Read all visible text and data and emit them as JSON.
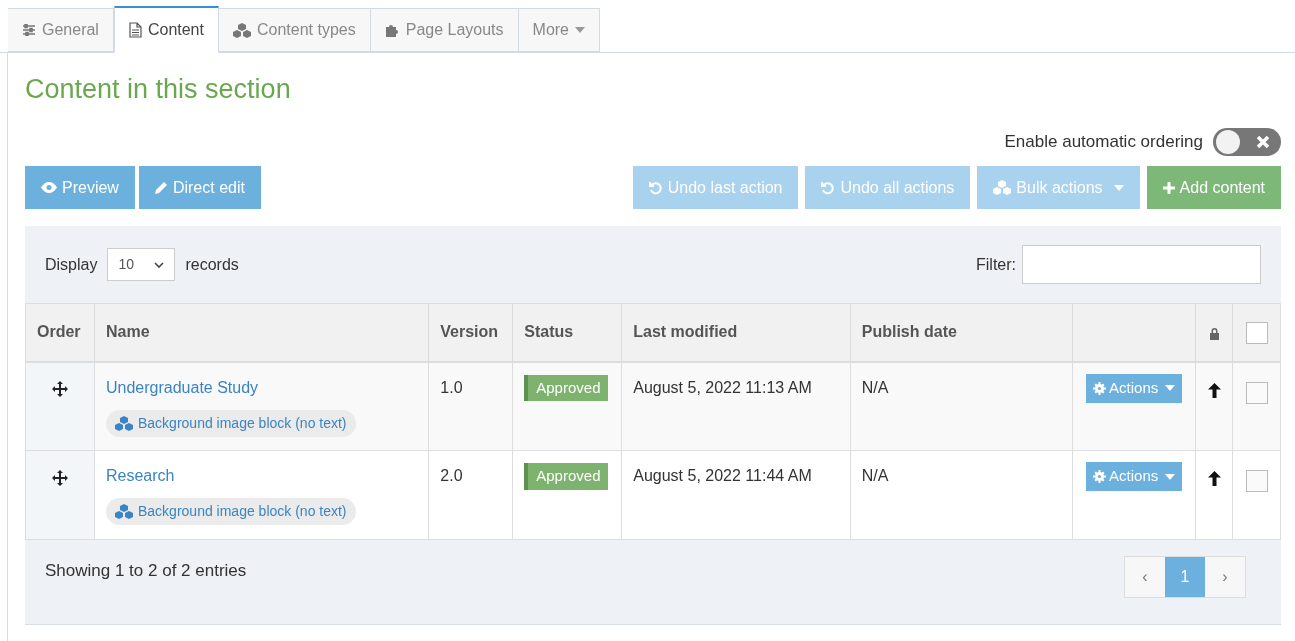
{
  "tabs": [
    {
      "label": "General",
      "selected": false,
      "dropdown": false
    },
    {
      "label": "Content",
      "selected": true,
      "dropdown": false
    },
    {
      "label": "Content types",
      "selected": false,
      "dropdown": false
    },
    {
      "label": "Page Layouts",
      "selected": false,
      "dropdown": false
    },
    {
      "label": "More",
      "selected": false,
      "dropdown": true
    }
  ],
  "heading": "Content in this section",
  "auto_ordering": {
    "label": "Enable automatic ordering",
    "on": false
  },
  "left_buttons": [
    {
      "label": "Preview"
    },
    {
      "label": "Direct edit"
    }
  ],
  "right_buttons": [
    {
      "label": "Undo last action",
      "kind": "light"
    },
    {
      "label": "Undo all actions",
      "kind": "light"
    },
    {
      "label": "Bulk actions",
      "kind": "dropdown"
    },
    {
      "label": "Add content",
      "kind": "success"
    }
  ],
  "display": {
    "label": "Display",
    "value": "10",
    "suffix": "records"
  },
  "filter": {
    "label": "Filter:"
  },
  "table": {
    "columns": [
      "Order",
      "Name",
      "Version",
      "Status",
      "Last modified",
      "Publish date"
    ],
    "select_all": {
      "checked": false
    },
    "rows": [
      {
        "name": "Undergraduate Study",
        "block": "Background image block (no text)",
        "version": "1.0",
        "status": "Approved",
        "last_modified": "August 5, 2022 11:13 AM",
        "publish_date": "N/A",
        "action": "Actions",
        "checked": false
      },
      {
        "name": "Research",
        "block": "Background image block (no text)",
        "version": "2.0",
        "status": "Approved",
        "last_modified": "August 5, 2022 11:44 AM",
        "publish_date": "N/A",
        "action": "Actions",
        "checked": false
      }
    ]
  },
  "footer": {
    "summary": "Showing 1 to 2 of 2 entries",
    "pages": [
      {
        "label": "‹",
        "selected": false
      },
      {
        "label": "1",
        "selected": true
      },
      {
        "label": "›",
        "selected": false
      }
    ]
  }
}
